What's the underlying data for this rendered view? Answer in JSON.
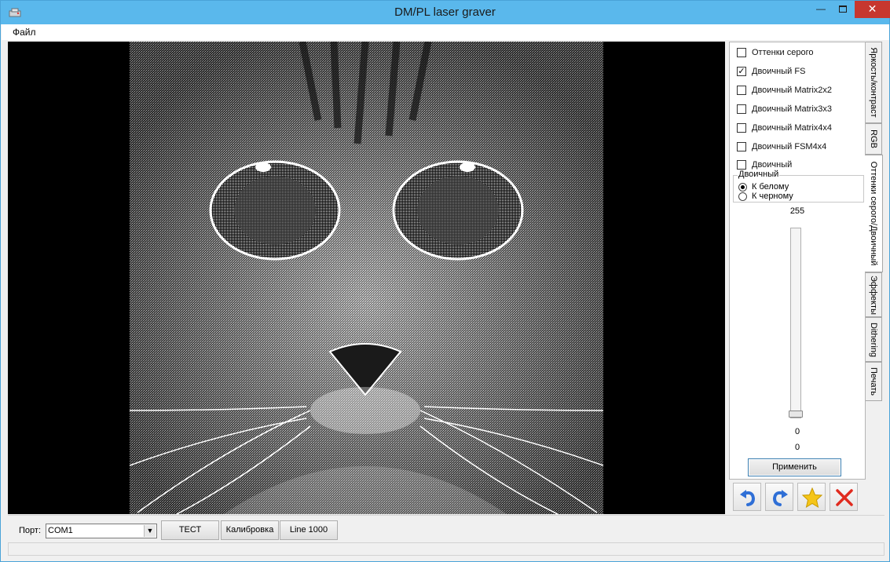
{
  "window": {
    "title": "DM/PL laser graver"
  },
  "menu": {
    "file": "Файл"
  },
  "panel": {
    "checkboxes": [
      {
        "label": "Оттенки серого",
        "checked": false
      },
      {
        "label": "Двоичный FS",
        "checked": true
      },
      {
        "label": "Двоичный Matrix2x2",
        "checked": false
      },
      {
        "label": "Двоичный Matrix3x3",
        "checked": false
      },
      {
        "label": "Двоичный Matrix4x4",
        "checked": false
      },
      {
        "label": "Двоичный FSM4x4",
        "checked": false
      },
      {
        "label": "Двоичный",
        "checked": false
      }
    ],
    "group_title": "Двоичный",
    "radios": [
      {
        "label": "К белому",
        "selected": true
      },
      {
        "label": "К черному",
        "selected": false
      }
    ],
    "slider_max": "255",
    "slider_value": "0",
    "value_readout": "0",
    "apply_label": "Применить"
  },
  "tabs": [
    {
      "label": "Яркость/контраст",
      "active": false
    },
    {
      "label": "RGB",
      "active": false
    },
    {
      "label": "Оттенки серого/Двоичный",
      "active": true
    },
    {
      "label": "Эффекты",
      "active": false
    },
    {
      "label": "Dithering",
      "active": false
    },
    {
      "label": "Печать",
      "active": false
    }
  ],
  "toolbar": {
    "undo_icon": "undo-icon",
    "redo_icon": "redo-icon",
    "favorite_icon": "star-icon",
    "cancel_icon": "close-icon",
    "colors": {
      "arrow": "#2f6fd6",
      "star": "#f5c518",
      "cross": "#e02a1e"
    }
  },
  "bottom": {
    "port_label": "Порт:",
    "port_value": "COM1",
    "test_label": "ТЕСТ",
    "calibration_label": "Калибровка",
    "line_label": "Line 1000"
  }
}
